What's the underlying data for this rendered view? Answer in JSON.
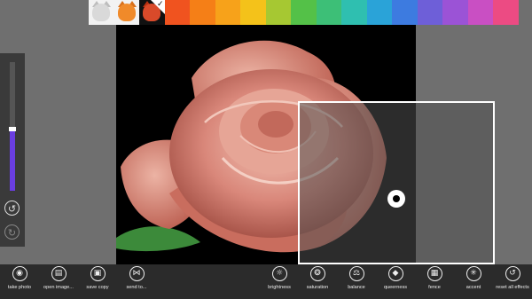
{
  "palette": {
    "thumbnails": [
      {
        "name": "sketch-cat-thumbnail",
        "cat": "#d9d9d9",
        "ear": "#bdbdbd"
      },
      {
        "name": "orange-cat-thumbnail",
        "cat": "#f08a2a",
        "ear": "#d9701a"
      },
      {
        "name": "red-cat-thumbnail",
        "cat": "#d94a2a",
        "ear": "#b83010",
        "selected": true
      }
    ],
    "colors": [
      "#f0531f",
      "#f57f17",
      "#f7a21a",
      "#f4c21a",
      "#a6c832",
      "#54c148",
      "#3dbf77",
      "#2fbfb0",
      "#2aa3d8",
      "#3d7be0",
      "#6e5fd8",
      "#9b53d6",
      "#c94fc3",
      "#ec4b83"
    ],
    "check_glyph": "✓"
  },
  "tool_panel": {
    "intensity_fraction": 0.48,
    "undo_glyph": "↺",
    "redo_glyph": "↻"
  },
  "app_bar": {
    "left": [
      {
        "name": "take-photo-button",
        "icon": "camera-icon",
        "glyph": "◉",
        "label": "take photo"
      },
      {
        "name": "open-image-button",
        "icon": "file-icon",
        "glyph": "▤",
        "label": "open image..."
      },
      {
        "name": "save-copy-button",
        "icon": "save-icon",
        "glyph": "▣",
        "label": "save copy"
      },
      {
        "name": "send-to-button",
        "icon": "share-icon",
        "glyph": "⋈",
        "label": "send to..."
      }
    ],
    "right": [
      {
        "name": "brightness-button",
        "icon": "sun-icon",
        "glyph": "☼",
        "label": "brightness"
      },
      {
        "name": "saturation-button",
        "icon": "saturation-icon",
        "glyph": "❂",
        "label": "saturation"
      },
      {
        "name": "balance-button",
        "icon": "balance-icon",
        "glyph": "⚖",
        "label": "balance"
      },
      {
        "name": "queerness-button",
        "icon": "diamond-icon",
        "glyph": "◆",
        "label": "queerness"
      },
      {
        "name": "fence-button",
        "icon": "fence-icon",
        "glyph": "▦",
        "label": "fence"
      },
      {
        "name": "accent-button",
        "icon": "accent-icon",
        "glyph": "✳",
        "label": "accent"
      },
      {
        "name": "reset-all-effects-button",
        "icon": "reset-icon",
        "glyph": "↺",
        "label": "reset all effects"
      }
    ]
  }
}
